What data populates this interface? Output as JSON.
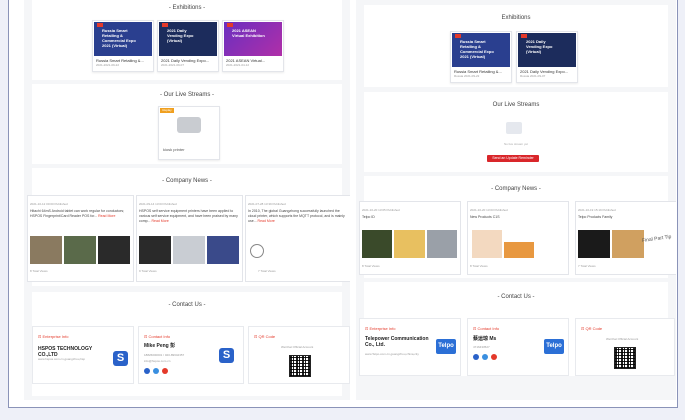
{
  "colors": {
    "accent": "#e4392a",
    "brand": "#2a62c9"
  },
  "left": {
    "exhibitions_title": "- Exhibitions -",
    "exhibitions": [
      {
        "title": "Russia Smart Retailing &...",
        "date": "2021-2021-09-22",
        "thumb_text": "Russia Smart Retailing & Commercial Expo 2021 (Virtual)",
        "bg": "#2a3f8f"
      },
      {
        "title": "2021 Daily Vending Expo...",
        "date": "2021-2021-09-07",
        "thumb_text": "2021 Daily Vending Expo (Virtual)",
        "bg": "#1c2c5c"
      },
      {
        "title": "2021 ASEAN Virtual...",
        "date": "2021-2021-04-12",
        "thumb_text": "2021 ASEAN Virtual Exhibition",
        "bg": "#5a2fa8"
      }
    ],
    "live_title": "- Our Live Streams -",
    "live": {
      "badge": "Replay",
      "caption": "kiosk printer"
    },
    "news_title": "- Company News -",
    "news": [
      {
        "date": "2021-10-12 00:00 Published",
        "text": "Hitachi 64mS Android tablet can work regular for conductors; HSPOS Fingerprint/Card Reader POS for...",
        "more": "Read More",
        "views": "8 Total Views"
      },
      {
        "date": "2021-09-14 13:03 Published",
        "text": "HSPOS self service equipment printers have been applied to various self service equipment, and have been praised by many comp...",
        "more": "Read More",
        "views": "9 Total Views"
      },
      {
        "date": "2021-07-28 13:39 Published",
        "text": "In 2010, The global Guangzhong successfully launched the cloud printer, which supports the MQTT protocol, and is mainly use...",
        "more": "Read More",
        "views": "7 Total Views"
      }
    ],
    "contact_title": "- Contact Us -",
    "contact": {
      "ent_head": "Enterprise Info",
      "ent_name": "HSPOS TECHNOLOGY CO.,LTD",
      "ent_addr": "www.hspos.com.cn,guangzhou,hsp",
      "person_head": "Contact Info",
      "person_name": "Mike Peng 彭",
      "person_l1": "18826000001 / 020-89642357",
      "person_l2": "info@hspos.com.cn",
      "qr_head": "QR Code",
      "qr_caption": "WeChat Official Account"
    }
  },
  "right": {
    "exhibitions_title": "Exhibitions",
    "exhibitions": [
      {
        "title": "Russia Smart Retailing &...",
        "date": "Russia 2021-09-22",
        "thumb_text": "Russia Smart Retailing & Commercial Expo 2021 (Virtual)",
        "bg": "#2a3f8f"
      },
      {
        "title": "2021 Daily Vending Expo...",
        "date": "Russia 2021-09-07",
        "thumb_text": "2021 Daily Vending Expo (Virtual)",
        "bg": "#1c2c5c"
      }
    ],
    "live_title": "Our Live Streams",
    "live_empty": "No live stream yet",
    "live_button": "Send an Update Reminder",
    "news_title": "- Company News -",
    "news": [
      {
        "date": "2021-10-20 13:05 Published",
        "text": "Telpo ID",
        "views": "8 Total Views"
      },
      {
        "date": "2021-10-20 13:03 Published",
        "text": "New Products C1S",
        "views": "8 Total Views"
      },
      {
        "date": "2021-10-19 15:19 Published",
        "text": "Telpo Products Family",
        "views": "7 Total Views",
        "overlay": "Final Part Tip"
      }
    ],
    "contact_title": "- Contact Us -",
    "contact": {
      "ent_head": "Enterprise Info",
      "ent_name": "Telepower Communication Co., Ltd.",
      "ent_addr": "www.Telpo.com.cn,guangzhou,china,city",
      "person_head": "Contact Info",
      "person_name": "蔡运琼 Ms",
      "person_l1": "4716433527",
      "qr_head": "QR Code",
      "qr_caption": "WeChat Official Account",
      "logo": "Telpo"
    }
  }
}
